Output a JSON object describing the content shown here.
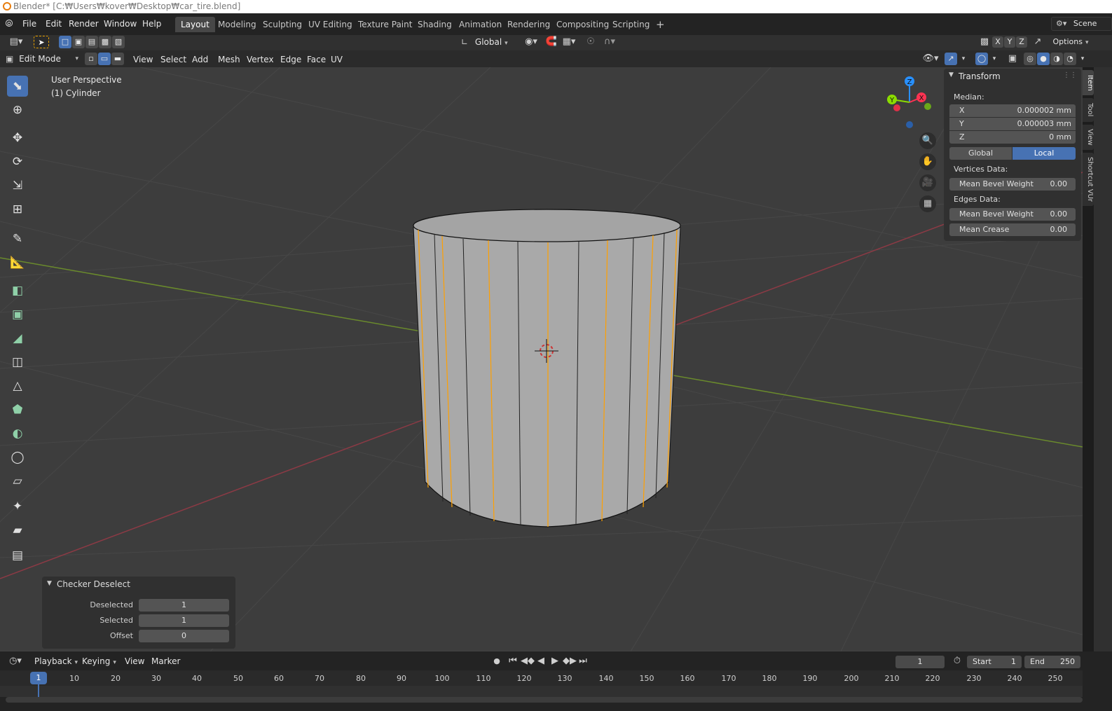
{
  "window": {
    "title": "Blender* [C:₩Users₩kover₩Desktop₩car_tire.blend]"
  },
  "menubar": {
    "items": [
      "File",
      "Edit",
      "Render",
      "Window",
      "Help"
    ]
  },
  "workspaces": {
    "tabs": [
      "Layout",
      "Modeling",
      "Sculpting",
      "UV Editing",
      "Texture Paint",
      "Shading",
      "Animation",
      "Rendering",
      "Compositing",
      "Scripting"
    ],
    "active": "Layout",
    "add_label": "+",
    "scene_label": "Scene"
  },
  "tool_header": {
    "orientation": "Global",
    "options_label": "Options",
    "axis_x": "X",
    "axis_y": "Y",
    "axis_z": "Z"
  },
  "editor_header": {
    "mode": "Edit Mode",
    "menus": [
      "View",
      "Select",
      "Add",
      "Mesh",
      "Vertex",
      "Edge",
      "Face",
      "UV"
    ]
  },
  "viewport": {
    "view_name": "User Perspective",
    "object_name": "(1) Cylinder",
    "gizmo": {
      "x": "X",
      "y": "Y",
      "z": "Z"
    }
  },
  "n_panel": {
    "title": "Transform",
    "median_label": "Median:",
    "x_label": "X",
    "x_value": "0.000002 mm",
    "y_label": "Y",
    "y_value": "0.000003 mm",
    "z_label": "Z",
    "z_value": "0 mm",
    "global_label": "Global",
    "local_label": "Local",
    "vertices_label": "Vertices Data:",
    "v_bevel_label": "Mean Bevel Weight",
    "v_bevel_value": "0.00",
    "edges_label": "Edges Data:",
    "e_bevel_label": "Mean Bevel Weight",
    "e_bevel_value": "0.00",
    "crease_label": "Mean Crease",
    "crease_value": "0.00",
    "tabs": [
      "Item",
      "Tool",
      "View",
      "Shortcut VUr"
    ]
  },
  "operator_panel": {
    "title": "Checker Deselect",
    "deselected_label": "Deselected",
    "deselected_value": "1",
    "selected_label": "Selected",
    "selected_value": "1",
    "offset_label": "Offset",
    "offset_value": "0"
  },
  "timeline": {
    "menus": [
      "Playback",
      "Keying",
      "View",
      "Marker"
    ],
    "current_frame": "1",
    "start_label": "Start",
    "start_value": "1",
    "end_label": "End",
    "end_value": "250",
    "ruler": [
      "1",
      "10",
      "20",
      "30",
      "40",
      "50",
      "60",
      "70",
      "80",
      "90",
      "100",
      "110",
      "120",
      "130",
      "140",
      "150",
      "160",
      "170",
      "180",
      "190",
      "200",
      "210",
      "220",
      "230",
      "240",
      "250"
    ]
  },
  "colors": {
    "accent": "#4772b3",
    "x_axis": "#ff3352",
    "y_axis": "#8bdc00",
    "z_axis": "#2890ff",
    "selected_edge": "#ffa000"
  }
}
